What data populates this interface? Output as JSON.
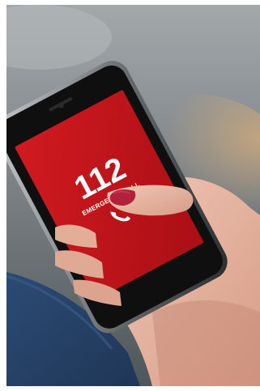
{
  "photo": {
    "screen": {
      "number": "112",
      "caption": "EMERGENCY CALL",
      "icon": "phone-handset-icon",
      "color": "#c4161c"
    },
    "colors": {
      "background_top": "#9aa0a3",
      "background_bottom": "#5b6266",
      "phone_body": "#111111",
      "phone_rim": "#8c8f92",
      "skin": "#e8b7a3",
      "nail": "#b0213b",
      "denim": "#2f4f7a"
    }
  }
}
